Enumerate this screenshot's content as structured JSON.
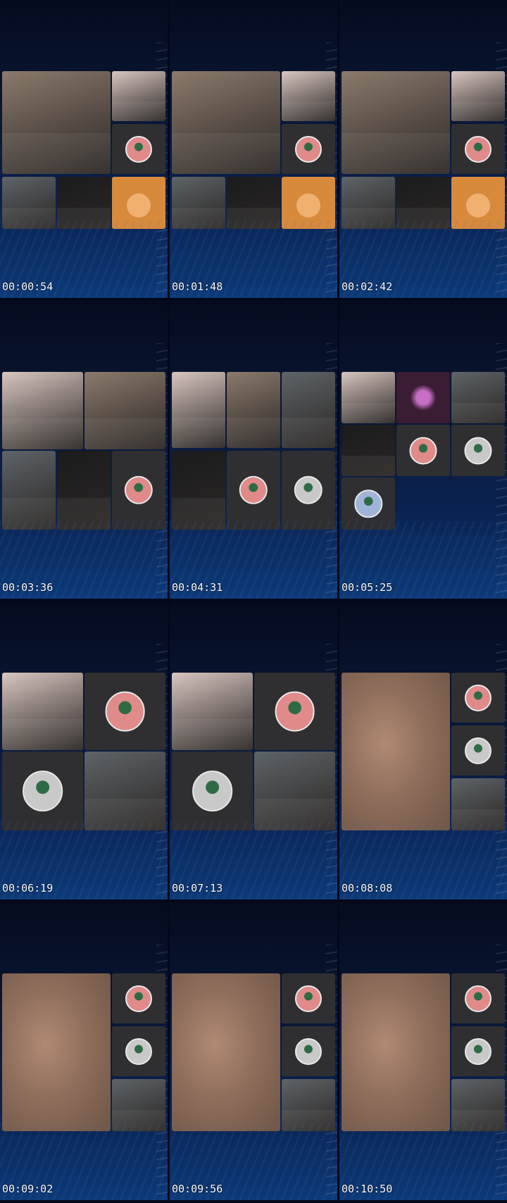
{
  "timestamps": [
    "00:00:54",
    "00:01:48",
    "00:02:42",
    "00:03:36",
    "00:04:31",
    "00:05:25",
    "00:06:19",
    "00:07:13",
    "00:08:08",
    "00:09:02",
    "00:09:56",
    "00:10:50"
  ],
  "colors": {
    "woman-video": "#8b7a6c",
    "woman2-video": "#d8c6c0",
    "man-video": "#5e6468",
    "boy-video": "#1b1b1d",
    "food-video": "#d7893c",
    "avatar-tile": "#2f2f31",
    "blurred-video": "#9a7a66",
    "pink-video": "#3a1c33"
  }
}
